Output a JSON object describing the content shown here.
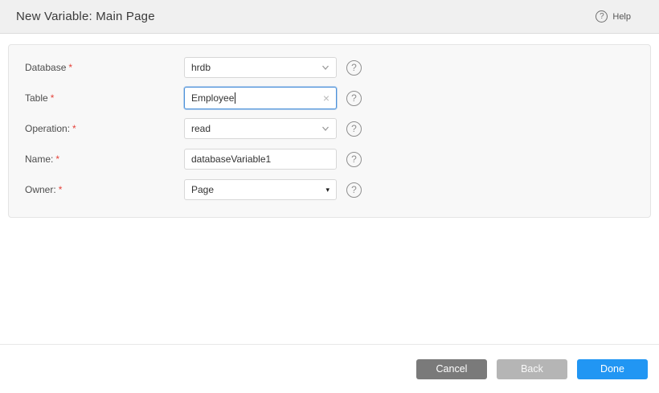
{
  "header": {
    "title": "New Variable: Main Page",
    "help_label": "Help",
    "help_icon_glyph": "?"
  },
  "form": {
    "required_marker": "*",
    "fields": [
      {
        "label": "Database",
        "value": "hrdb",
        "control": "dropdown"
      },
      {
        "label": "Table",
        "value": "Employee",
        "control": "text-focused-clearable"
      },
      {
        "label": "Operation:",
        "value": "read",
        "control": "dropdown"
      },
      {
        "label": "Name:",
        "value": "databaseVariable1",
        "control": "text"
      },
      {
        "label": "Owner:",
        "value": "Page",
        "control": "native-select"
      }
    ],
    "field_help_glyph": "?",
    "clear_icon_glyph": "×",
    "select_arrow_glyph": "▾"
  },
  "footer": {
    "buttons": [
      {
        "label": "Cancel"
      },
      {
        "label": "Back"
      },
      {
        "label": "Done"
      }
    ]
  },
  "colors": {
    "accent_blue": "#2196f3",
    "focus_border_blue": "#4a90d9",
    "required_red": "#e5433b",
    "cancel_gray": "#7a7a7a",
    "back_gray": "#b5b5b5",
    "header_bg": "#f0f0f0",
    "panel_bg": "#f8f8f8"
  }
}
